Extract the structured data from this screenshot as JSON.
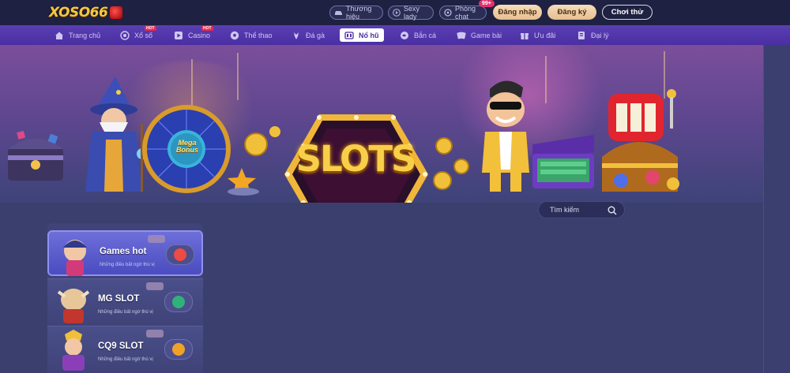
{
  "brand": {
    "logo_text": "XOSO66"
  },
  "topbar": {
    "pills": [
      {
        "label": "Thương hiệu",
        "icon": "car-icon"
      },
      {
        "label": "Sexy lady",
        "icon": "play-icon"
      },
      {
        "label": "Phòng chat",
        "icon": "chat-icon"
      }
    ],
    "chat_badge": "99+",
    "login_label": "Đăng nhập",
    "register_label": "Đăng ký",
    "try_label": "Chơi thử"
  },
  "nav": {
    "items": [
      {
        "label": "Trang chủ",
        "icon": "home-icon",
        "hot": false,
        "active": false
      },
      {
        "label": "Xổ số",
        "icon": "lottery-icon",
        "hot": true,
        "active": false
      },
      {
        "label": "Casino",
        "icon": "casino-icon",
        "hot": true,
        "active": false
      },
      {
        "label": "Thể thao",
        "icon": "soccer-ball-icon",
        "hot": false,
        "active": false
      },
      {
        "label": "Đá gà",
        "icon": "rooster-icon",
        "hot": false,
        "active": false
      },
      {
        "label": "Nổ hũ",
        "icon": "slot-machine-icon",
        "hot": false,
        "active": true
      },
      {
        "label": "Bắn cá",
        "icon": "fish-icon",
        "hot": false,
        "active": false
      },
      {
        "label": "Game bài",
        "icon": "cards-icon",
        "hot": false,
        "active": false
      },
      {
        "label": "Ưu đãi",
        "icon": "gift-icon",
        "hot": false,
        "active": false
      },
      {
        "label": "Đại lý",
        "icon": "agent-icon",
        "hot": false,
        "active": false
      }
    ],
    "hot_label": "HOT"
  },
  "banner": {
    "title": "SLOTS",
    "wheel_text": "Mega Bonus"
  },
  "search": {
    "placeholder": "Tìm kiếm"
  },
  "categories": [
    {
      "title": "Games hot",
      "subtitle": "Những điều bất ngờ thú vị",
      "active": true,
      "logo_color": "#ee4b45"
    },
    {
      "title": "MG SLOT",
      "subtitle": "Những điều bất ngờ thú vị",
      "active": false,
      "logo_color": "#2fb27a"
    },
    {
      "title": "CQ9 SLOT",
      "subtitle": "Những điều bất ngờ thú vị",
      "active": false,
      "logo_color": "#f0a227"
    }
  ],
  "colors": {
    "nav_bg": "#4a2fa2",
    "topbar_bg": "#1f2142",
    "gold": "#f3c742",
    "page_bg": "#3a3f6e"
  }
}
